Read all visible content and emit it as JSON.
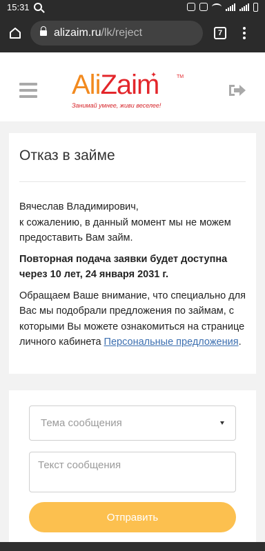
{
  "status_bar": {
    "time": "15:31"
  },
  "browser": {
    "url_host": "alizaim.ru",
    "url_path": "/lk/reject",
    "tab_count": "7"
  },
  "header": {
    "logo_ali": "Ali",
    "logo_zaim": "Zaim",
    "logo_tm": "TM",
    "slogan": "Занимай умнее, живи веселее!"
  },
  "card": {
    "title": "Отказ в займе",
    "greeting_line1": "Вячеслав Владимирович,",
    "greeting_line2": "к сожалению, в данный момент мы не можем предоставить Вам займ.",
    "notice": "Повторная подача заявки будет доступна через 10 лет, 24 января 2031 г.",
    "info": "Обращаем Ваше внимание, что специально для Вас мы подобрали предложения по займам, с которыми Вы можете ознакомиться на странице личного кабинета",
    "link_text": "Персональные предложения",
    "link_suffix": "."
  },
  "form": {
    "topic_placeholder": "Тема сообщения",
    "message_placeholder": "Текст сообщения",
    "submit_label": "Отправить"
  },
  "colors": {
    "accent": "#fcc04f",
    "brand_orange": "#f28a1f",
    "brand_red": "#e3262b",
    "link": "#3c6fb0"
  }
}
